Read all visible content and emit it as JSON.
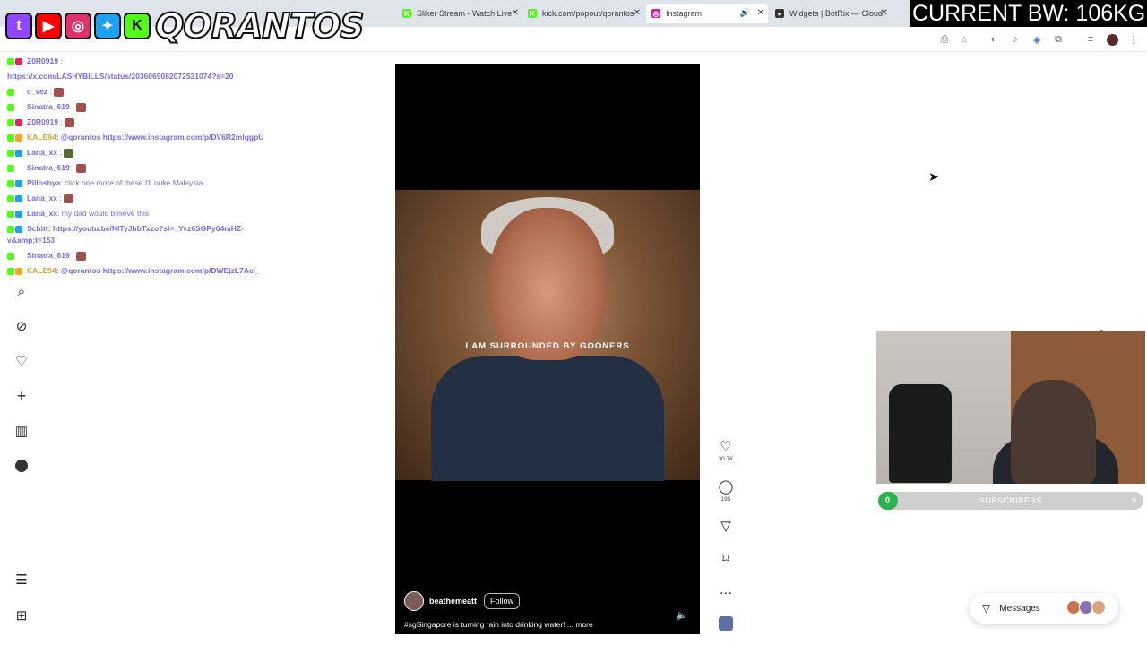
{
  "browser": {
    "tabs": [
      {
        "label": "Sliker Stream - Watch Live",
        "icon": "kick-icon",
        "color": "#53fc18"
      },
      {
        "label": "kick.com/popout/qorantos",
        "icon": "kick-icon",
        "color": "#53fc18"
      },
      {
        "label": "Instagram",
        "icon": "instagram-icon",
        "color": "#d6249f",
        "active": true
      },
      {
        "label": "Widgets | BotRix — Cloud",
        "icon": "github-icon",
        "color": "#333333"
      }
    ]
  },
  "overlay": {
    "brand": "QORANTOS",
    "bandwidth": "CURRENT BW: 106KG",
    "socials": [
      {
        "name": "twitch-icon",
        "glyph": "t",
        "color": "#9146ff"
      },
      {
        "name": "youtube-icon",
        "glyph": "▶",
        "color": "#ff0000"
      },
      {
        "name": "instagram-icon",
        "glyph": "◎",
        "color": "#e1306c"
      },
      {
        "name": "twitter-icon",
        "glyph": "🐦",
        "color": "#1da1f2"
      },
      {
        "name": "kick-icon",
        "glyph": "K",
        "color": "#53fc18"
      }
    ]
  },
  "chat": [
    {
      "user": "Z0R0919",
      "text": ":",
      "color": "#6a5acd"
    },
    {
      "user": "",
      "text": "https://x.com/LASHYBILLS/status/2036069082072531074?s=20",
      "color": "#6a5acd"
    },
    {
      "user": "c_vez",
      "text": ":",
      "color": "#9b8be0"
    },
    {
      "user": "Sinatra_619",
      "text": ":",
      "color": "#9b8be0"
    },
    {
      "user": "Z0R0919",
      "text": ":",
      "color": "#6a5acd"
    },
    {
      "user": "KALE94",
      "text": ": @qorantos https://www.instagram.com/p/DV6R2mlggpU",
      "color": "#c8a24a"
    },
    {
      "user": "Lana_xx",
      "text": ":",
      "color": "#9b8be0"
    },
    {
      "user": "Sinatra_619",
      "text": ":",
      "color": "#9b8be0"
    },
    {
      "user": "Pillosbya",
      "text": ": click one more of these I'll nuke Malaysia",
      "color": "#9b8be0"
    },
    {
      "user": "Lana_xx",
      "text": ":",
      "color": "#9b8be0"
    },
    {
      "user": "Lana_xx",
      "text": ": my dad would believe this",
      "color": "#9b8be0"
    },
    {
      "user": "Schitt",
      "text": ": https://youtu.be/NITyJhbTxzo?si=_Yvz6SGPy64mHZ-v&amp;t=153",
      "color": "#6a5acd"
    },
    {
      "user": "Sinatra_619",
      "text": ":",
      "color": "#9b8be0"
    },
    {
      "user": "KALE94",
      "text": ": @qorantos https://www.instagram.com/p/DWEjzL7Aci_",
      "color": "#c8a24a"
    }
  ],
  "nav": [
    "search-icon",
    "compass-icon",
    "heart-icon",
    "create-icon",
    "dashboard-icon",
    "profile-icon"
  ],
  "reel": {
    "caption_text": "I AM SURROUNDED BY GOONERS",
    "author": "beathemeatt",
    "follow": "Follow",
    "description": "#sgSingapore is turning rain into drinking water! ... more",
    "likes": "30.7K",
    "comments": "195"
  },
  "stream": {
    "subscribers_label": "SUBSCRIBERS",
    "subscribers_count": "0",
    "subscribers_goal": "5",
    "subscribers_fraction": 0.0
  },
  "messages_label": "Messages"
}
